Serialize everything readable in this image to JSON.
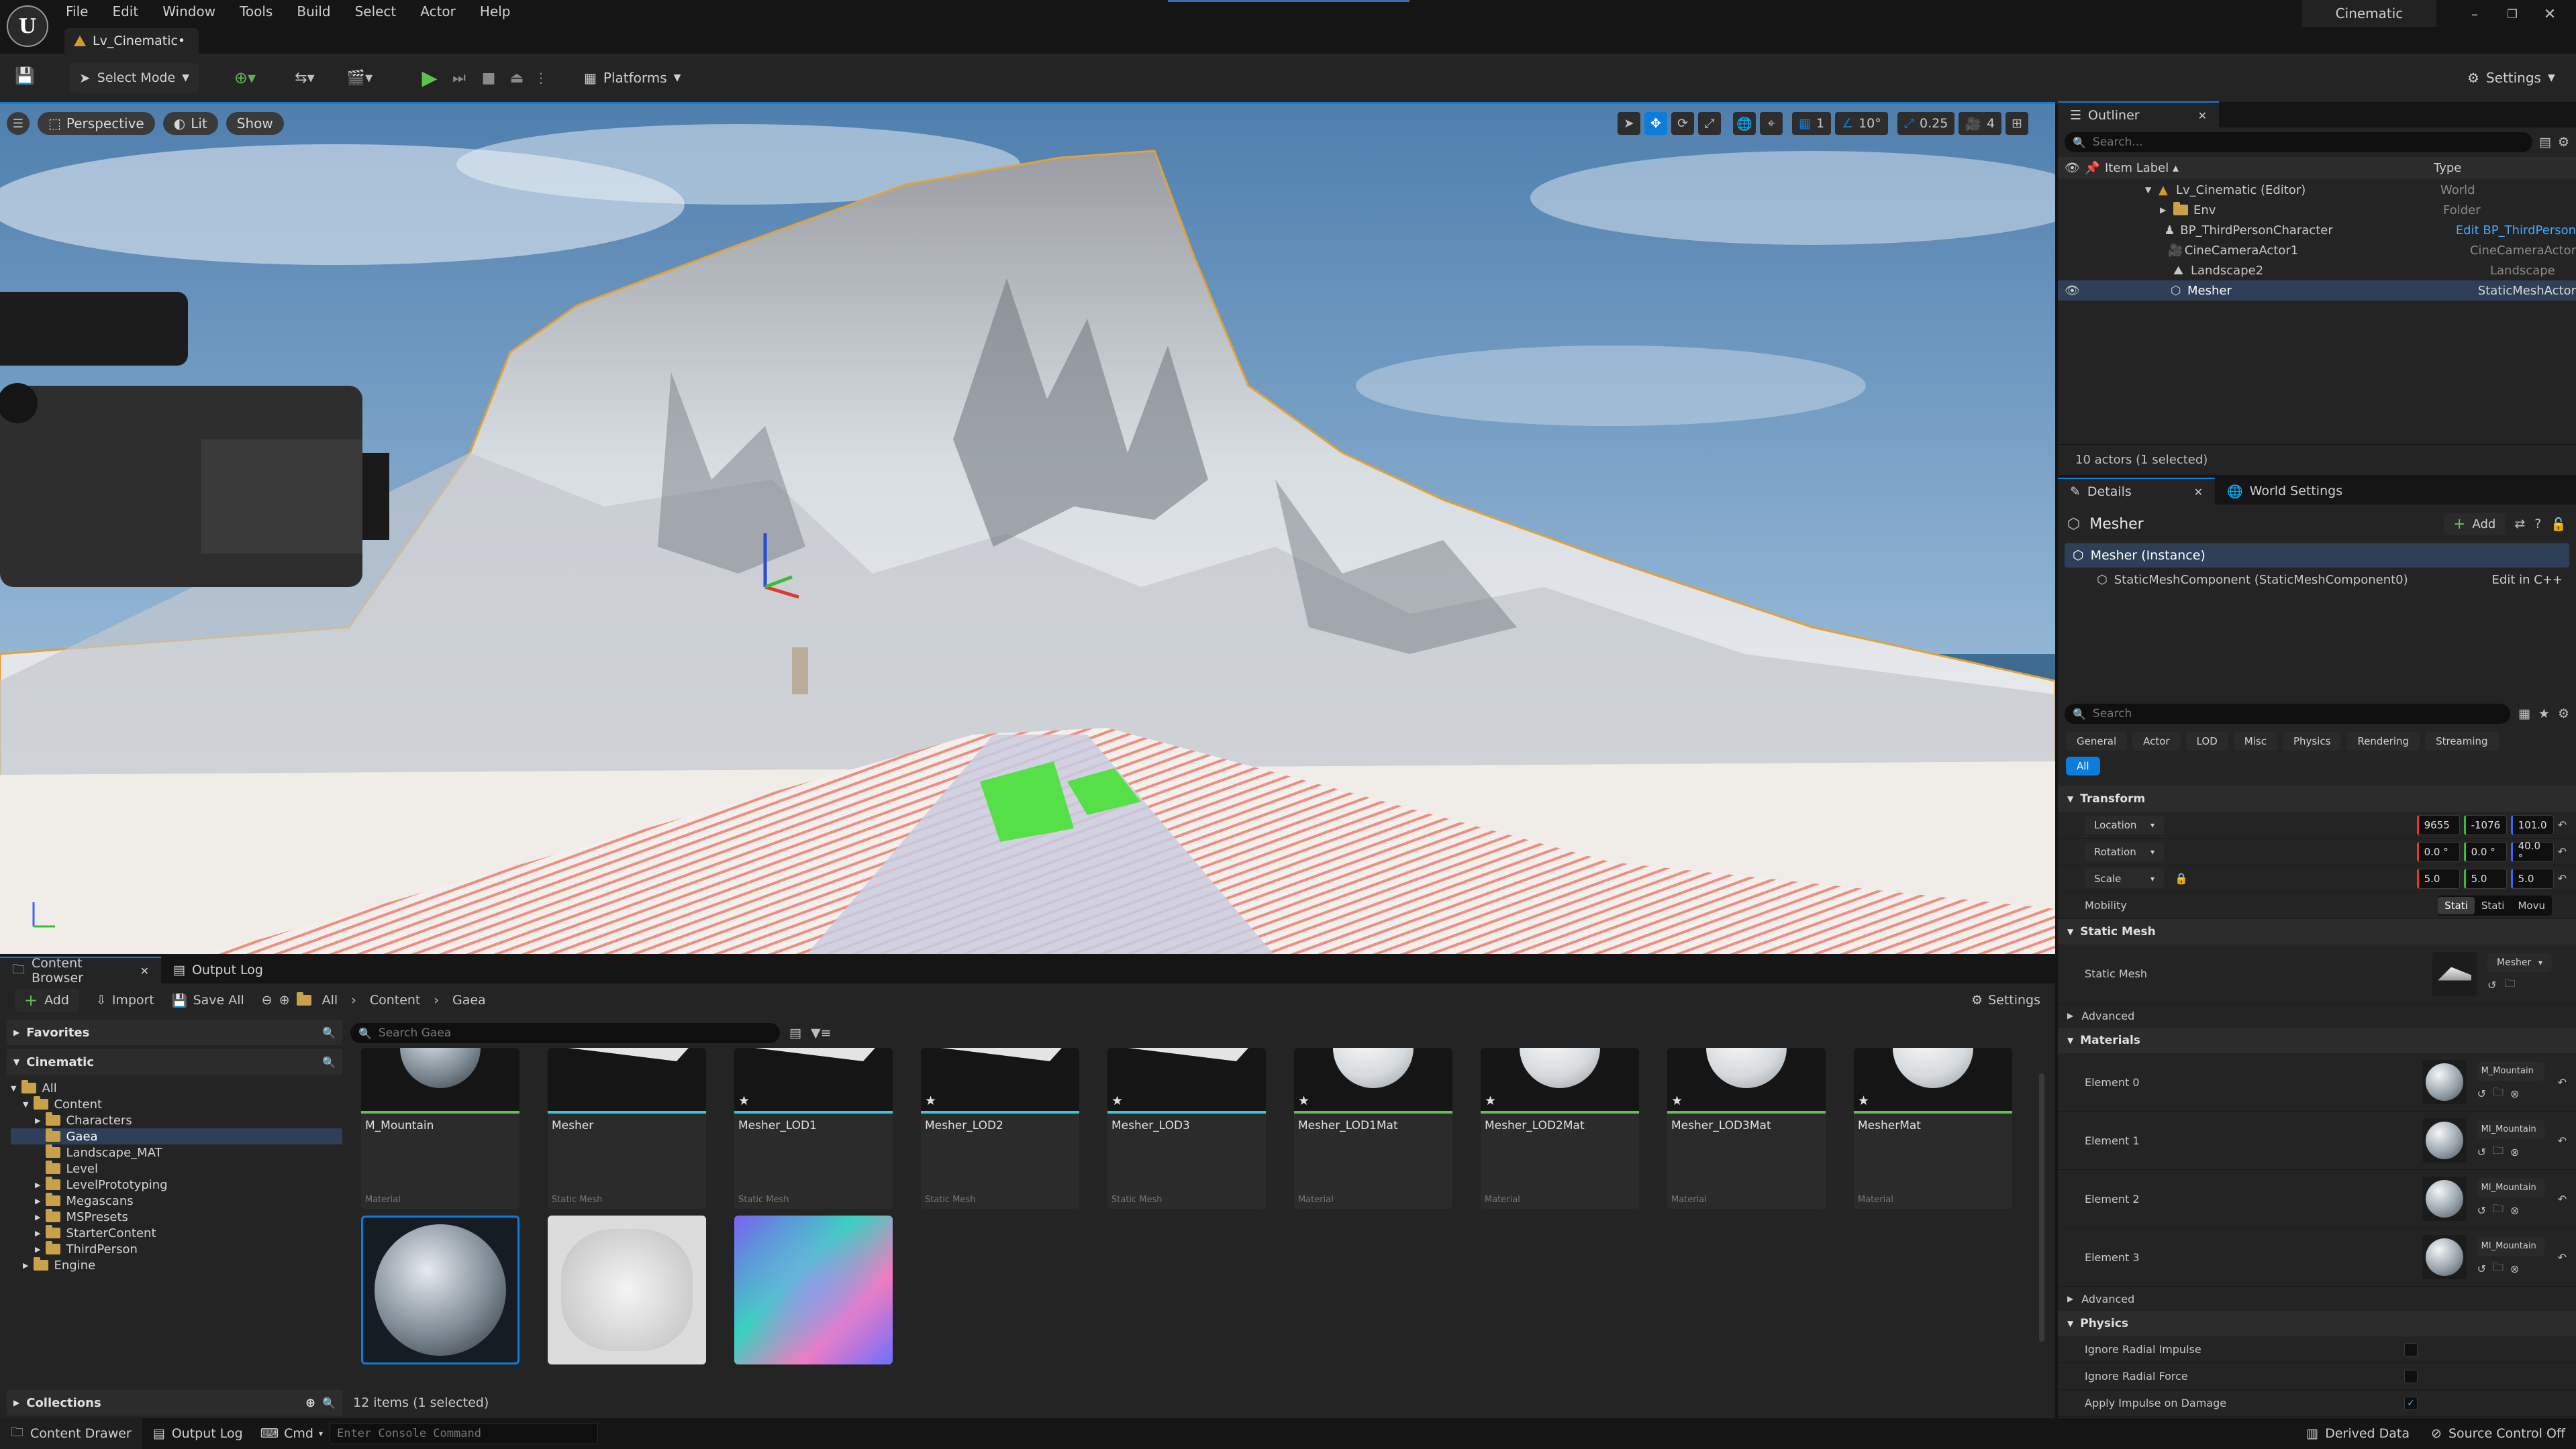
{
  "menu": {
    "items": [
      "File",
      "Edit",
      "Window",
      "Tools",
      "Build",
      "Select",
      "Actor",
      "Help"
    ],
    "tab_label": "Lv_Cinematic•",
    "layout_label": "Cinematic"
  },
  "toolbar": {
    "select_mode": "Select Mode",
    "platforms": "Platforms",
    "settings": "Settings"
  },
  "viewport": {
    "perspective": "Perspective",
    "lit": "Lit",
    "show": "Show",
    "grid_value": "1",
    "angle_value": "10°",
    "scale_value": "0.25",
    "camera_speed": "4"
  },
  "outliner": {
    "title": "Outliner",
    "search_placeholder": "Search...",
    "col_label": "Item Label ▴",
    "col_type": "Type",
    "rows": [
      {
        "label": "Lv_Cinematic (Editor)",
        "type": "World"
      },
      {
        "label": "Env",
        "type": "Folder"
      },
      {
        "label": "BP_ThirdPersonCharacter",
        "type": "Edit BP_ThirdPerson"
      },
      {
        "label": "CineCameraActor1",
        "type": "CineCameraActor"
      },
      {
        "label": "Landscape2",
        "type": "Landscape"
      },
      {
        "label": "Mesher",
        "type": "StaticMeshActor"
      }
    ],
    "status": "10 actors (1 selected)"
  },
  "details": {
    "tab_details": "Details",
    "tab_world": "World Settings",
    "actor_name": "Mesher",
    "add": "Add",
    "instance": "Mesher (Instance)",
    "component": "StaticMeshComponent (StaticMeshComponent0)",
    "edit_cpp": "Edit in C++",
    "search_placeholder": "Search",
    "filters": [
      "General",
      "Actor",
      "LOD",
      "Misc",
      "Physics",
      "Rendering",
      "Streaming"
    ],
    "filter_all": "All",
    "transform_header": "Transform",
    "location_label": "Location",
    "rotation_label": "Rotation",
    "scale_label": "Scale",
    "location": [
      "9655",
      "-1076",
      "101.0"
    ],
    "rotation": [
      "0.0 °",
      "0.0 °",
      "40.0 °"
    ],
    "scale": [
      "5.0",
      "5.0",
      "5.0"
    ],
    "mobility_label": "Mobility",
    "mobility_options": [
      "Stati",
      "Stati",
      "Movu"
    ],
    "static_mesh_header": "Static Mesh",
    "static_mesh_label": "Static Mesh",
    "static_mesh_value": "Mesher",
    "advanced": "Advanced",
    "materials_header": "Materials",
    "elements": [
      {
        "label": "Element 0",
        "value": "M_Mountain"
      },
      {
        "label": "Element 1",
        "value": "MI_Mountain"
      },
      {
        "label": "Element 2",
        "value": "MI_Mountain"
      },
      {
        "label": "Element 3",
        "value": "MI_Mountain"
      }
    ],
    "advanced2": "Advanced",
    "physics_header": "Physics",
    "physics_rows": [
      "Ignore Radial Impulse",
      "Ignore Radial Force",
      "Apply Impulse on Damage"
    ]
  },
  "content_browser": {
    "tab": "Content Browser",
    "tab_output": "Output Log",
    "add": "Add",
    "import": "Import",
    "save_all": "Save All",
    "breadcrumb": [
      "All",
      "Content",
      "Gaea"
    ],
    "settings": "Settings",
    "favorites": "Favorites",
    "cinematic": "Cinematic",
    "search_placeholder": "Search Gaea",
    "tree": [
      {
        "label": "All",
        "depth": 0
      },
      {
        "label": "Content",
        "depth": 1
      },
      {
        "label": "Characters",
        "depth": 2
      },
      {
        "label": "Gaea",
        "depth": 2
      },
      {
        "label": "Landscape_MAT",
        "depth": 2
      },
      {
        "label": "Level",
        "depth": 2
      },
      {
        "label": "LevelPrototyping",
        "depth": 2
      },
      {
        "label": "Megascans",
        "depth": 2
      },
      {
        "label": "MSPresets",
        "depth": 2
      },
      {
        "label": "StarterContent",
        "depth": 2
      },
      {
        "label": "ThirdPerson",
        "depth": 2
      },
      {
        "label": "Engine",
        "depth": 1
      }
    ],
    "collections": "Collections",
    "assets": [
      {
        "name": "M_Mountain",
        "type": "Material"
      },
      {
        "name": "Mesher",
        "type": "Static Mesh"
      },
      {
        "name": "Mesher_LOD1",
        "type": "Static Mesh"
      },
      {
        "name": "Mesher_LOD2",
        "type": "Static Mesh"
      },
      {
        "name": "Mesher_LOD3",
        "type": "Static Mesh"
      },
      {
        "name": "Mesher_LOD1Mat",
        "type": "Material"
      },
      {
        "name": "Mesher_LOD2Mat",
        "type": "Material"
      },
      {
        "name": "Mesher_LOD3Mat",
        "type": "Material"
      },
      {
        "name": "MesherMat",
        "type": "Material"
      }
    ],
    "status": "12 items (1 selected)"
  },
  "statusbar": {
    "content_drawer": "Content Drawer",
    "output_log": "Output Log",
    "cmd": "Cmd",
    "console_placeholder": "Enter Console Command",
    "derived_data": "Derived Data",
    "source_control": "Source Control Off"
  }
}
